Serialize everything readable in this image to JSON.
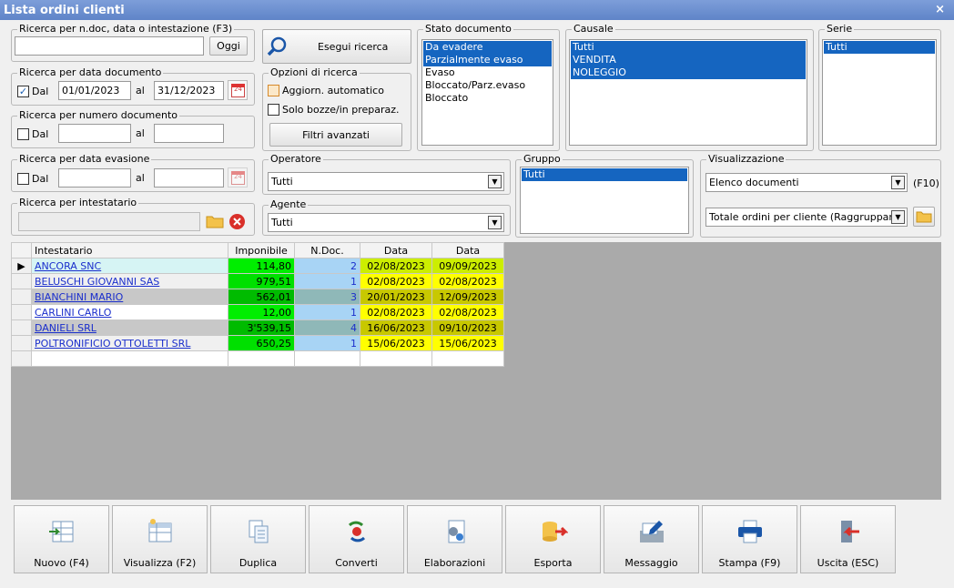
{
  "window": {
    "title": "Lista ordini clienti",
    "close": "×"
  },
  "search_text": {
    "legend": "Ricerca per n.doc, data o intestazione (F3)",
    "value": "",
    "oggi_label": "Oggi"
  },
  "search_button": {
    "label": "Esegui ricerca"
  },
  "date_doc": {
    "legend": "Ricerca per data documento",
    "checked": true,
    "check_mark": "✓",
    "dal_label": "Dal",
    "from": "01/01/2023",
    "al_label": "al",
    "to": "31/12/2023",
    "cal_text": "24"
  },
  "num_doc": {
    "legend": "Ricerca per numero documento",
    "dal_label": "Dal",
    "al_label": "al"
  },
  "options": {
    "legend": "Opzioni di ricerca",
    "auto_update": "Aggiorn. automatico",
    "drafts": "Solo bozze/in preparaz.",
    "advanced": "Filtri avanzati"
  },
  "date_evas": {
    "legend": "Ricerca per data evasione",
    "dal_label": "Dal",
    "al_label": "al",
    "cal_text": "24"
  },
  "holder": {
    "legend": "Ricerca per intestatario"
  },
  "operator": {
    "legend": "Operatore",
    "value": "Tutti"
  },
  "agent": {
    "legend": "Agente",
    "value": "Tutti"
  },
  "doc_state": {
    "legend": "Stato documento",
    "items": [
      {
        "label": "Da evadere",
        "selected": true
      },
      {
        "label": "Parzialmente evaso",
        "selected": true
      },
      {
        "label": "Evaso",
        "selected": false
      },
      {
        "label": "Bloccato/Parz.evaso",
        "selected": false
      },
      {
        "label": "Bloccato",
        "selected": false
      }
    ]
  },
  "causale": {
    "legend": "Causale",
    "items": [
      {
        "label": "Tutti",
        "selected": true
      },
      {
        "label": "VENDITA",
        "selected": true
      },
      {
        "label": "NOLEGGIO",
        "selected": true
      }
    ]
  },
  "serie": {
    "legend": "Serie",
    "items": [
      {
        "label": "Tutti",
        "selected": true
      }
    ]
  },
  "gruppo": {
    "legend": "Gruppo",
    "items": [
      {
        "label": "Tutti",
        "selected": true
      }
    ]
  },
  "view": {
    "legend": "Visualizzazione",
    "mode": "Elenco documenti",
    "hotkey": "(F10)",
    "grouping": "Totale ordini per cliente (Raggruppam"
  },
  "grid": {
    "headers": [
      "Intestatario",
      "Imponibile",
      "N.Doc.",
      "Data",
      "Data"
    ],
    "current_row_marker": "▶",
    "rows": [
      {
        "name": "ANCORA SNC",
        "amount": "114,80",
        "ndoc": "2",
        "date1": "02/08/2023",
        "date2": "09/09/2023"
      },
      {
        "name": "BELUSCHI GIOVANNI SAS",
        "amount": "979,51",
        "ndoc": "1",
        "date1": "02/08/2023",
        "date2": "02/08/2023"
      },
      {
        "name": "BIANCHINI MARIO",
        "amount": "562,01",
        "ndoc": "3",
        "date1": "20/01/2023",
        "date2": "12/09/2023"
      },
      {
        "name": "CARLINI CARLO",
        "amount": "12,00",
        "ndoc": "1",
        "date1": "02/08/2023",
        "date2": "02/08/2023"
      },
      {
        "name": "DANIELI SRL",
        "amount": "3'539,15",
        "ndoc": "4",
        "date1": "16/06/2023",
        "date2": "09/10/2023"
      },
      {
        "name": "POLTRONIFICIO OTTOLETTI SRL",
        "amount": "650,25",
        "ndoc": "1",
        "date1": "15/06/2023",
        "date2": "15/06/2023"
      }
    ]
  },
  "toolbar": [
    {
      "label": "Nuovo (F4)",
      "icon": "new-icon"
    },
    {
      "label": "Visualizza (F2)",
      "icon": "view-icon"
    },
    {
      "label": "Duplica",
      "icon": "duplicate-icon"
    },
    {
      "label": "Converti",
      "icon": "convert-icon"
    },
    {
      "label": "Elaborazioni",
      "icon": "process-icon"
    },
    {
      "label": "Esporta",
      "icon": "export-icon"
    },
    {
      "label": "Messaggio",
      "icon": "message-icon"
    },
    {
      "label": "Stampa (F9)",
      "icon": "print-icon"
    },
    {
      "label": "Uscita (ESC)",
      "icon": "exit-icon"
    }
  ],
  "colors": {
    "selection": "#1565c0",
    "amount_green": "#00ee00",
    "ndoc_blue": "#9ccbee",
    "date_yellow": "#ffff00",
    "date_olive": "#c8c800"
  }
}
